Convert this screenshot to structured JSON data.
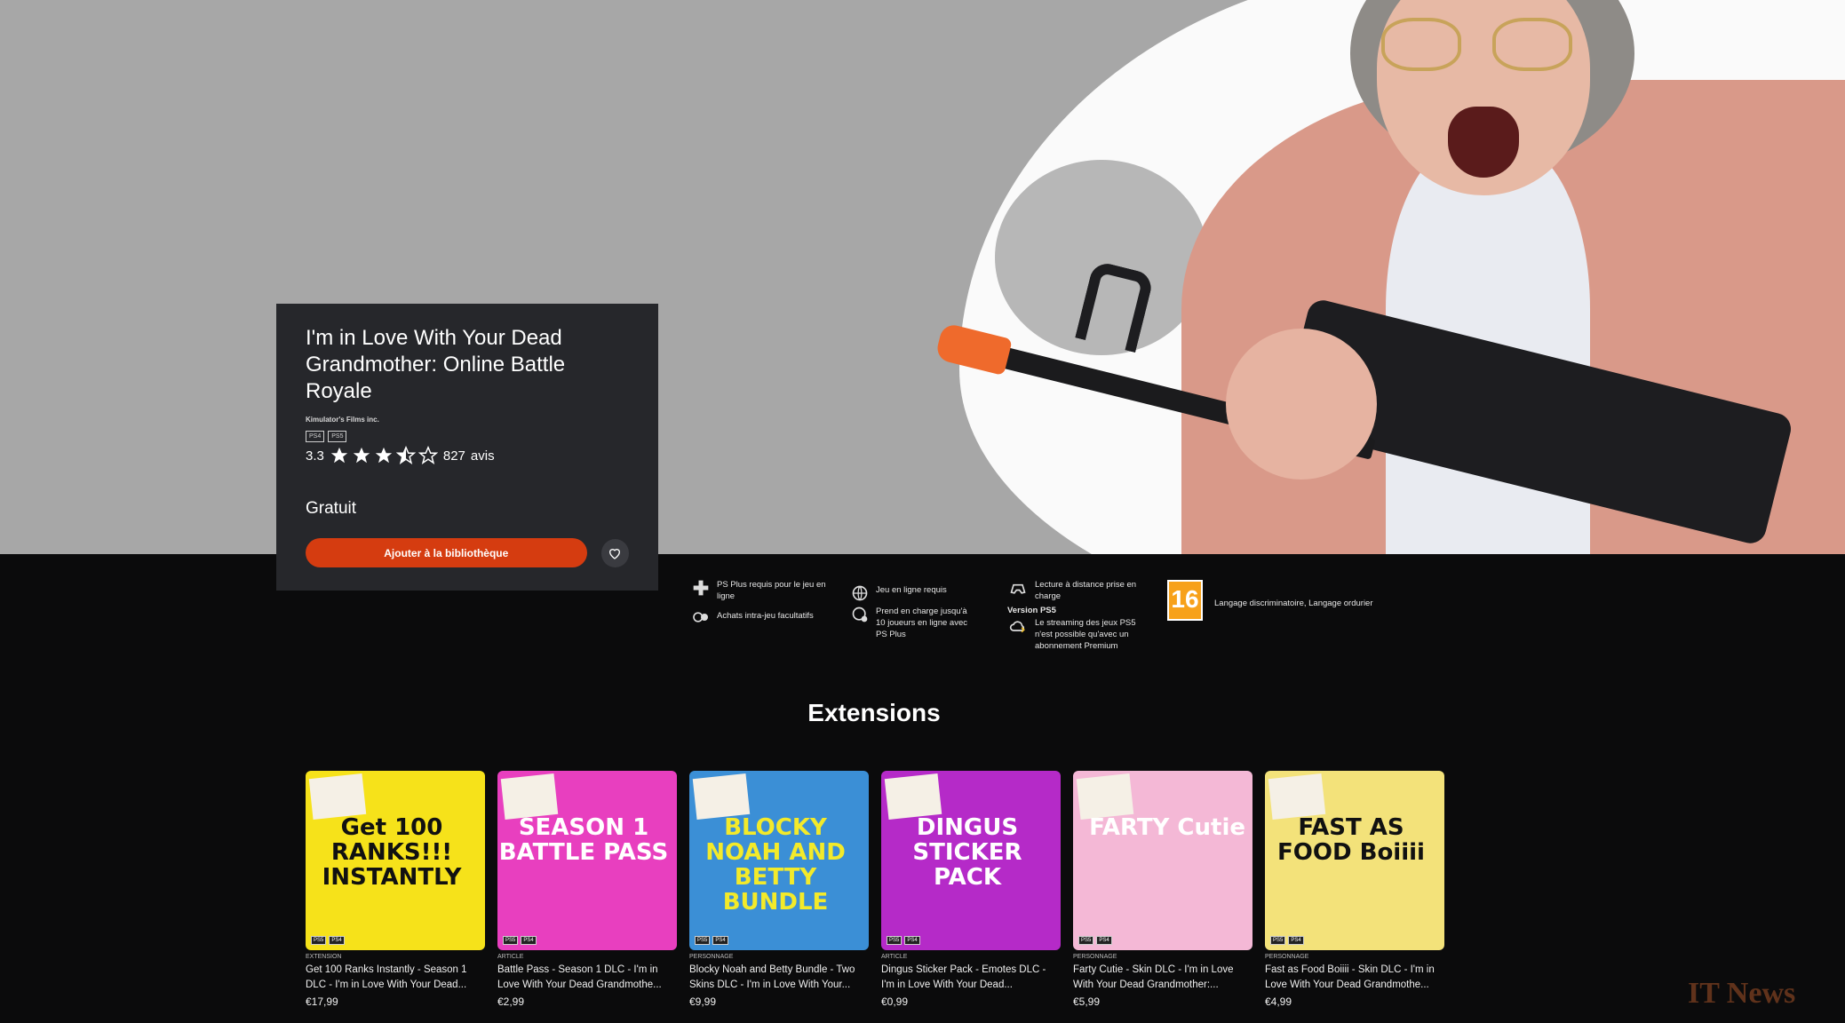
{
  "game": {
    "title": "I'm in Love With Your Dead Grandmother: Online Battle Royale",
    "publisher": "Kimulator's Films inc.",
    "platforms": [
      "PS4",
      "PS5"
    ],
    "rating": "3.3",
    "stars_value": 3.5,
    "reviews_count": "827",
    "reviews_label": "avis",
    "price": "Gratuit",
    "add_button": "Ajouter à la bibliothèque"
  },
  "features": {
    "psplus": [
      "PS Plus requis pour le jeu en",
      "ligne"
    ],
    "iap": "Achats intra-jeu facultatifs",
    "online": "Jeu en ligne requis",
    "players": [
      "Prend en charge jusqu'à",
      "10 joueurs en ligne avec",
      "PS Plus"
    ],
    "remote": [
      "Lecture à distance prise en",
      "charge"
    ],
    "version": "Version PS5",
    "streaming": [
      "Le streaming des jeux PS5",
      "n'est possible qu'avec un",
      "abonnement Premium"
    ],
    "age": "16",
    "descriptors": "Langage discriminatoire, Langage ordurier"
  },
  "extensions": {
    "heading": "Extensions",
    "items": [
      {
        "kind": "Extension",
        "name": "Get 100 Ranks Instantly - Season 1 DLC - I'm in Love With Your Dead...",
        "price": "€17,99",
        "art_text": "Get 100 RANKS!!! INSTANTLY",
        "bg": "#f6e21a",
        "fg": "#111"
      },
      {
        "kind": "Article",
        "name": "Battle Pass - Season 1 DLC - I'm in Love With Your Dead Grandmothe...",
        "price": "€2,99",
        "art_text": "SEASON 1 BATTLE PASS",
        "bg": "#e83fbf",
        "fg": "#fff"
      },
      {
        "kind": "Personnage",
        "name": "Blocky Noah and Betty Bundle - Two Skins DLC - I'm in Love With Your...",
        "price": "€9,99",
        "art_text": "BLOCKY NOAH AND BETTY BUNDLE",
        "bg": "#3b8fd6",
        "fg": "#f3ea2a"
      },
      {
        "kind": "Article",
        "name": "Dingus Sticker Pack - Emotes DLC - I'm in Love With Your Dead...",
        "price": "€0,99",
        "art_text": "DINGUS STICKER PACK",
        "bg": "#b52ac8",
        "fg": "#fff"
      },
      {
        "kind": "Personnage",
        "name": "Farty Cutie - Skin DLC - I'm in Love With Your Dead Grandmother:...",
        "price": "€5,99",
        "art_text": "FARTY Cutie",
        "bg": "#f4b8d6",
        "fg": "#fff"
      },
      {
        "kind": "Personnage",
        "name": "Fast as Food Boiiii - Skin DLC - I'm in Love With Your Dead Grandmothe...",
        "price": "€4,99",
        "art_text": "FAST AS FOOD Boiiii",
        "bg": "#f3e27a",
        "fg": "#111"
      }
    ]
  },
  "watermark": "IT News",
  "colors": {
    "accent": "#d53c10",
    "card_bg": "#26272b",
    "page_bg": "#0b0b0c"
  }
}
